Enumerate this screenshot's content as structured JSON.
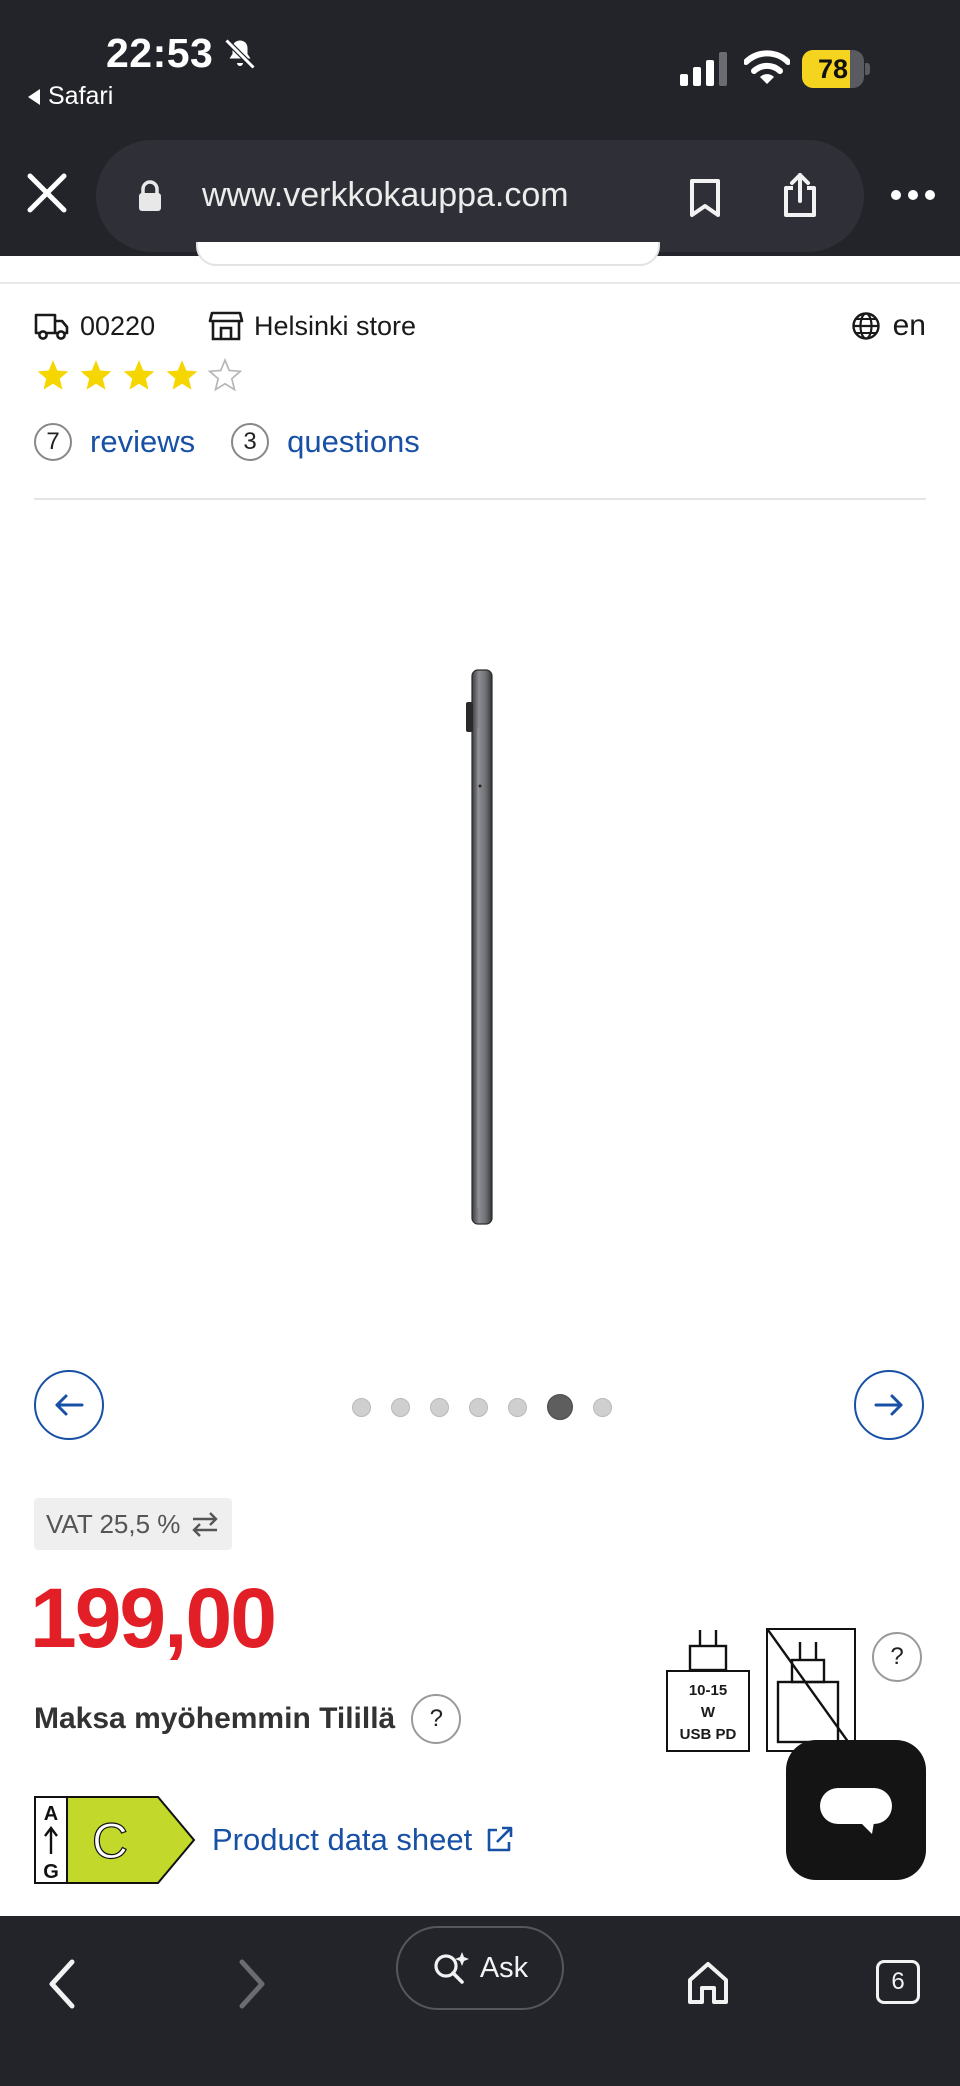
{
  "status_bar": {
    "time": "22:53",
    "back_app": "Safari",
    "battery_level": "78",
    "battery_fraction": 0.78,
    "icons": [
      "bell-slash-icon",
      "cellular-signal-icon",
      "wifi-icon",
      "battery-icon"
    ]
  },
  "browser": {
    "url": "www.verkkokauppa.com",
    "ask_label": "Ask",
    "tab_count": "6",
    "icons": [
      "close-icon",
      "lock-icon",
      "bookmark-icon",
      "share-icon",
      "more-icon",
      "back-icon",
      "forward-icon",
      "ask-icon",
      "home-icon",
      "tabs-icon"
    ]
  },
  "header": {
    "postal_code": "00220",
    "store": "Helsinki store",
    "language": "en"
  },
  "rating": {
    "stars": 4,
    "max_stars": 5,
    "reviews_count": "7",
    "reviews_label": "reviews",
    "questions_count": "3",
    "questions_label": "questions"
  },
  "gallery": {
    "total_images": 7,
    "active_index": 5
  },
  "pricing": {
    "vat_label": "VAT 25,5 %",
    "price": "199,00",
    "pay_later": "Maksa myöhemmin Tilillä",
    "help_symbol": "?"
  },
  "charger": {
    "line1": "10-15",
    "line2": "W",
    "line3": "USB PD"
  },
  "energy_label": {
    "top_class": "A",
    "bottom_class": "G",
    "rating": "C",
    "rating_color": "#c2d82b"
  },
  "datasheet": {
    "label": "Product data sheet"
  },
  "colors": {
    "accent": "#1750a5",
    "price": "#e21f26",
    "star": "#f6d600",
    "chrome": "#23242a"
  }
}
